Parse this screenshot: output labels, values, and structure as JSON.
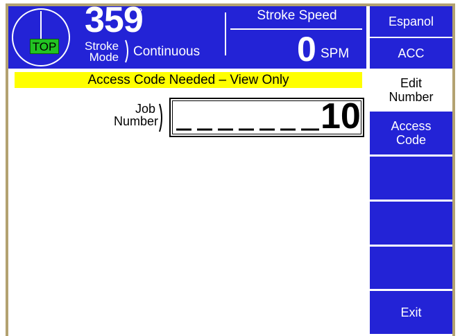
{
  "header": {
    "position_badge": "TOP",
    "crank_angle": "359",
    "degree_symbol": "°",
    "stroke_mode_label_line1": "Stroke",
    "stroke_mode_label_line2": "Mode",
    "stroke_mode_value": "Continuous",
    "stroke_speed_label": "Stroke Speed",
    "stroke_speed_value": "0",
    "stroke_speed_unit": "SPM"
  },
  "banner": {
    "message": "Access Code Needed – View Only",
    "color": "#ffff00"
  },
  "job": {
    "label_line1": "Job",
    "label_line2": "Number",
    "value": "10",
    "empty_digit_slots": 7
  },
  "softkeys": [
    {
      "id": "espanol",
      "label": "Espanol"
    },
    {
      "id": "acc",
      "label": "ACC"
    },
    {
      "id": "edit-number",
      "label_line1": "Edit",
      "label_line2": "Number"
    },
    {
      "id": "access-code",
      "label_line1": "Access",
      "label_line2": "Code"
    },
    {
      "id": "blank-1",
      "label": ""
    },
    {
      "id": "blank-2",
      "label": ""
    },
    {
      "id": "blank-3",
      "label": ""
    },
    {
      "id": "exit",
      "label": "Exit"
    }
  ],
  "colors": {
    "panel_blue": "#2323d6",
    "frame_tan": "#b3a271",
    "top_badge_green": "#22c322"
  },
  "icons": [
    "crank-position-dial-icon"
  ]
}
